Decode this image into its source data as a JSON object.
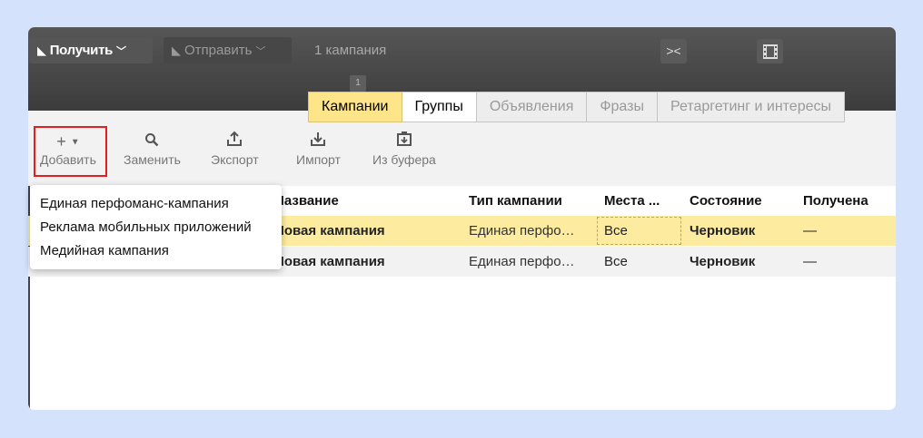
{
  "topbar": {
    "get_button": {
      "label": "Получить",
      "icon": "download-arrow-icon"
    },
    "send_button": {
      "label": "Отправить",
      "icon": "send-arrow-icon"
    },
    "campaign_count": "1 кампания",
    "collapse_icon": "collapse-arrows-icon",
    "film_icon": "film-icon",
    "tab_badge": "1"
  },
  "tabs": [
    {
      "label": "Кампании",
      "state": "active"
    },
    {
      "label": "Группы",
      "state": "enabled"
    },
    {
      "label": "Объявления",
      "state": "disabled"
    },
    {
      "label": "Фразы",
      "state": "disabled"
    },
    {
      "label": "Ретаргетинг и интересы",
      "state": "disabled"
    }
  ],
  "toolbar": {
    "add": "Добавить",
    "replace": "Заменить",
    "export": "Экспорт",
    "import": "Импорт",
    "from_buffer": "Из буфера"
  },
  "columns": {
    "name": "Название",
    "type": "Тип кампании",
    "places": "Места ...",
    "status": "Состояние",
    "received": "Получена"
  },
  "rows": [
    {
      "name": "Новая кампания",
      "type": "Единая перфо…",
      "places": "Все",
      "status": "Черновик",
      "received": "—"
    },
    {
      "name": "Новая кампания",
      "type": "Единая перфо…",
      "places": "Все",
      "status": "Черновик",
      "received": "—"
    }
  ],
  "dropdown": {
    "items": [
      "Единая перфоманс-кампания",
      "Реклама мобильных приложений",
      "Медийная кампания"
    ]
  },
  "colors": {
    "accent_yellow": "#ffe589",
    "selection_row": "#fdeca0",
    "highlight_red": "#e21e1e"
  }
}
